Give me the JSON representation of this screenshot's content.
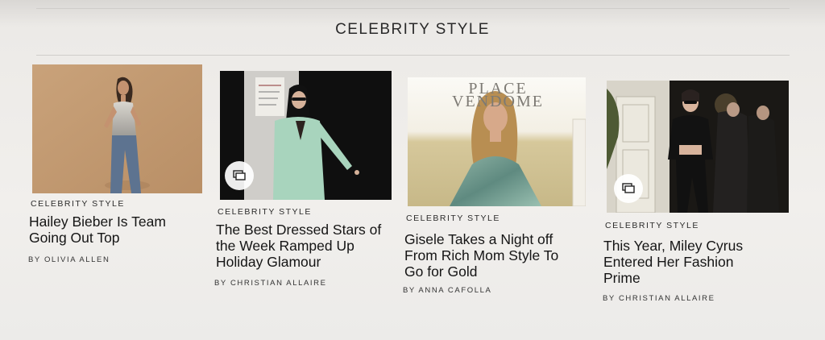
{
  "section": {
    "title": "CELEBRITY STYLE"
  },
  "articles": [
    {
      "kicker": "CELEBRITY STYLE",
      "headline": "Hailey Bieber Is Team Going Out Top",
      "byline": "BY OLIVIA ALLEN"
    },
    {
      "kicker": "CELEBRITY STYLE",
      "headline": "The Best Dressed Stars of the Week Ramped Up Holiday Glamour",
      "byline": "BY CHRISTIAN ALLAIRE",
      "gallery_icon": "gallery-icon"
    },
    {
      "kicker": "CELEBRITY STYLE",
      "headline": "Gisele Takes a Night off From Rich Mom Style To Go for Gold",
      "byline": "BY ANNA CAFOLLA",
      "image_logo": "PLACE VENDOME"
    },
    {
      "kicker": "CELEBRITY STYLE",
      "headline": "This Year, Miley Cyrus Entered Her Fashion Prime",
      "byline": "BY CHRISTIAN ALLAIRE",
      "gallery_icon": "gallery-icon"
    }
  ]
}
